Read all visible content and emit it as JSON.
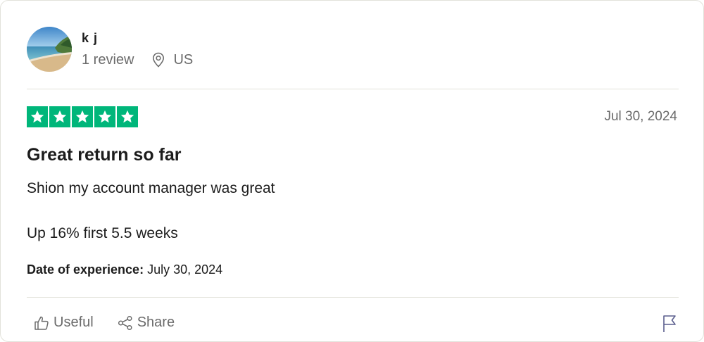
{
  "reviewer": {
    "name": "k j",
    "review_count": "1 review",
    "location": "US",
    "avatar_icon": "beach-photo"
  },
  "review": {
    "rating": 5,
    "max_rating": 5,
    "star_color": "#00b67a",
    "date": "Jul 30, 2024",
    "title": "Great return so far",
    "body": [
      "Shion my account manager was great",
      "Up 16% first 5.5 weeks"
    ],
    "experience_label": "Date of experience:",
    "experience_date": " July 30, 2024"
  },
  "actions": {
    "useful_label": "Useful",
    "share_label": "Share",
    "flag_icon": "flag-icon"
  }
}
